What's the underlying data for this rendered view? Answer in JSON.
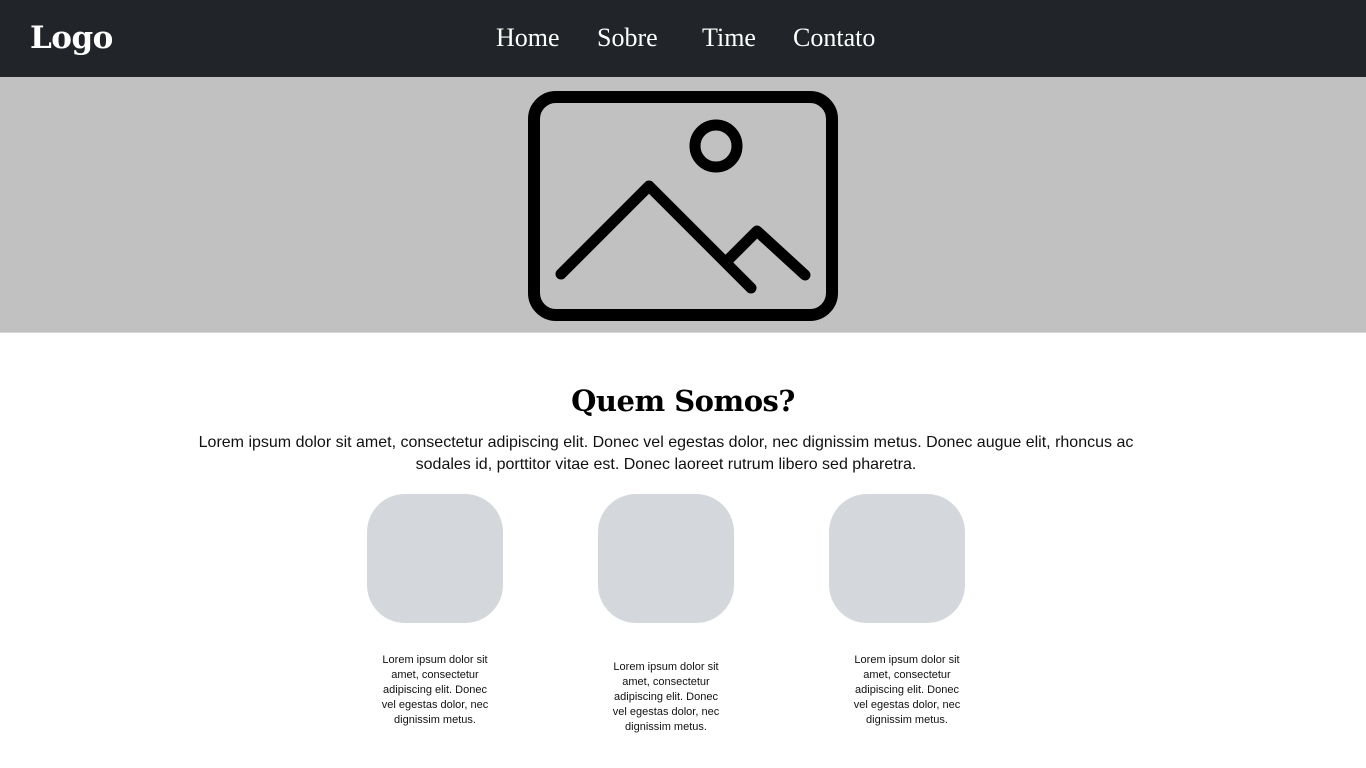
{
  "navbar": {
    "logo": "Logo",
    "links": [
      "Home",
      "Sobre",
      "Time",
      "Contato"
    ]
  },
  "hero": {
    "image_icon": "image-placeholder-icon",
    "background_color": "#c1c1c1"
  },
  "about": {
    "title": "Quem Somos?",
    "text": "Lorem ipsum dolor sit amet, consectetur adipiscing elit. Donec vel egestas dolor, nec dignissim metus. Donec augue elit, rhoncus ac sodales id, porttitor vitae est. Donec laoreet rutrum libero sed pharetra."
  },
  "cards": [
    {
      "text": "Lorem ipsum dolor sit amet, consectetur adipiscing elit. Donec vel egestas dolor, nec dignissim metus."
    },
    {
      "text": "Lorem ipsum dolor sit amet, consectetur adipiscing elit. Donec vel egestas dolor, nec dignissim metus."
    },
    {
      "text": "Lorem ipsum dolor sit amet, consectetur adipiscing elit. Donec vel egestas dolor, nec dignissim metus."
    }
  ],
  "colors": {
    "navbar": "#212529",
    "card_placeholder": "#d4d8dc"
  }
}
